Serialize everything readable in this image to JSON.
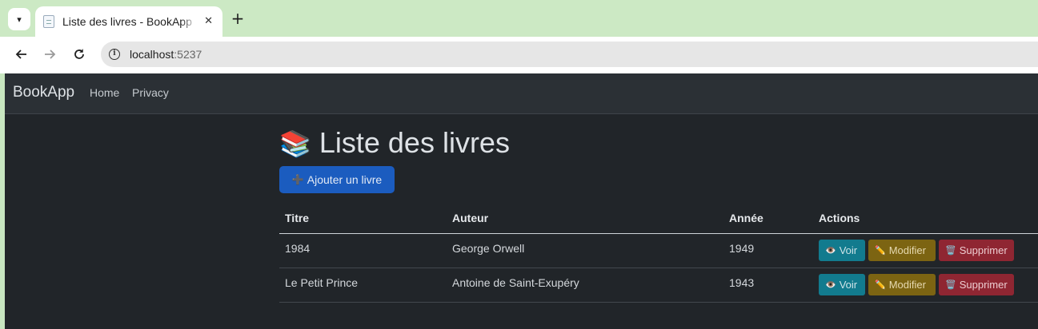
{
  "browser": {
    "tab_title": "Liste des livres - BookApp",
    "tab_close": "✕",
    "new_tab": "+",
    "url_host": "localhost",
    "url_port": ":5237",
    "icons": [
      "tab-search-icon",
      "document-favicon-icon",
      "back-arrow-icon",
      "forward-arrow-icon",
      "reload-icon",
      "info-icon"
    ]
  },
  "navbar": {
    "brand": "BookApp",
    "links": [
      "Home",
      "Privacy"
    ]
  },
  "main": {
    "title_emoji": "📚",
    "title": "Liste des livres",
    "add_button": {
      "icon": "➕",
      "label": "Ajouter un livre"
    },
    "table": {
      "headers": [
        "Titre",
        "Auteur",
        "Année",
        "Actions"
      ],
      "rows": [
        {
          "titre": "1984",
          "auteur": "George Orwell",
          "annee": "1949"
        },
        {
          "titre": "Le Petit Prince",
          "auteur": "Antoine de Saint-Exupéry",
          "annee": "1943"
        }
      ],
      "actions": {
        "view": {
          "icon": "👁️",
          "label": "Voir"
        },
        "edit": {
          "icon": "✏️",
          "label": "Modifier"
        },
        "delete": {
          "icon": "🗑️",
          "label": "Supprimer"
        }
      }
    }
  },
  "colors": {
    "page_bg": "#212529",
    "navbar_bg": "#2b3035",
    "primary": "#1b5cbf",
    "info": "#127b8e",
    "warning": "#7c6412",
    "danger": "#8f2632",
    "tabstrip": "#cce9c4"
  }
}
